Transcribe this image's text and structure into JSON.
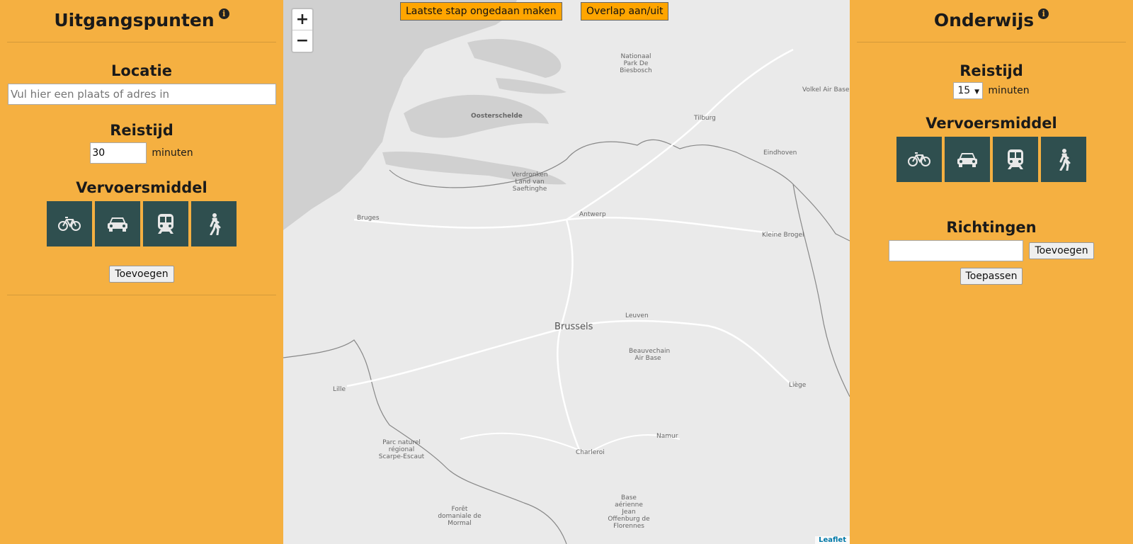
{
  "left": {
    "title": "Uitgangspunten",
    "info_glyph": "i",
    "location_title": "Locatie",
    "location_placeholder": "Vul hier een plaats of adres in",
    "travel_title": "Reistijd",
    "travel_value": "30",
    "minutes_label": "minuten",
    "transport_title": "Vervoersmiddel",
    "transport_icons": [
      "bicycle-icon",
      "car-icon",
      "train-icon",
      "walk-icon"
    ],
    "add_label": "Toevoegen"
  },
  "right": {
    "title": "Onderwijs",
    "info_glyph": "i",
    "travel_title": "Reistijd",
    "travel_selected": "15",
    "minutes_label": "minuten",
    "transport_title": "Vervoersmiddel",
    "transport_icons": [
      "bicycle-icon",
      "car-icon",
      "train-icon",
      "walk-icon"
    ],
    "directions_title": "Richtingen",
    "directions_value": "",
    "add_label": "Toevoegen",
    "apply_label": "Toepassen"
  },
  "map": {
    "undo_label": "Laatste stap ongedaan maken",
    "overlap_label": "Overlap aan/uit",
    "zoom_in": "+",
    "zoom_out": "−",
    "attribution": "Leaflet",
    "labels": {
      "np_biesbosch": "Nationaal Park De Biesbosch",
      "volkel": "Volkel Air Base",
      "oosterschelde": "Oosterschelde",
      "tilburg": "Tilburg",
      "eindhoven": "Eindhoven",
      "verdronken": "Verdronken Land van Saeftinghe",
      "bruges": "Bruges",
      "antwerp": "Antwerp",
      "kleine_brogel": "Kleine Brogel",
      "brussels": "Brussels",
      "leuven": "Leuven",
      "beauvechain": "Beauvechain Air Base",
      "lille": "Lille",
      "liege": "Liège",
      "scarpe": "Parc naturel régional Scarpe-Escaut",
      "namur": "Namur",
      "charleroi": "Charleroi",
      "florennes": "Base aérienne Jean Offenburg de Florennes",
      "mormal": "Forêt domaniale de Mormal"
    }
  },
  "colors": {
    "panel_bg": "#f5b041",
    "transport_bg": "#2f4f4f",
    "map_btn_bg": "#ffa500",
    "map_bg": "#eaeaea",
    "sea": "#d0d0d0"
  }
}
